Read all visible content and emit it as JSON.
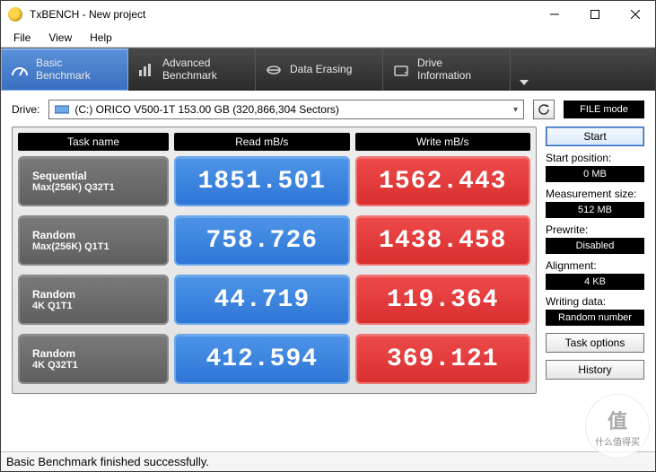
{
  "window": {
    "title": "TxBENCH - New project"
  },
  "menu": {
    "file": "File",
    "view": "View",
    "help": "Help"
  },
  "tabs": {
    "basic": "Basic\nBenchmark",
    "advanced": "Advanced\nBenchmark",
    "erase": "Data Erasing",
    "drive": "Drive\nInformation"
  },
  "drive": {
    "label": "Drive:",
    "value": "(C:) ORICO V500-1T  153.00 GB (320,866,304 Sectors)",
    "file_mode": "FILE mode"
  },
  "headers": {
    "task": "Task name",
    "read": "Read mB/s",
    "write": "Write mB/s"
  },
  "rows": [
    {
      "t1": "Sequential",
      "t2": "Max(256K) Q32T1",
      "read": "1851.501",
      "write": "1562.443"
    },
    {
      "t1": "Random",
      "t2": "Max(256K) Q1T1",
      "read": "758.726",
      "write": "1438.458"
    },
    {
      "t1": "Random",
      "t2": "4K Q1T1",
      "read": "44.719",
      "write": "119.364"
    },
    {
      "t1": "Random",
      "t2": "4K Q32T1",
      "read": "412.594",
      "write": "369.121"
    }
  ],
  "side": {
    "start": "Start",
    "startpos_lbl": "Start position:",
    "startpos_val": "0 MB",
    "msize_lbl": "Measurement size:",
    "msize_val": "512 MB",
    "prewrite_lbl": "Prewrite:",
    "prewrite_val": "Disabled",
    "align_lbl": "Alignment:",
    "align_val": "4 KB",
    "wdata_lbl": "Writing data:",
    "wdata_val": "Random number",
    "taskopt": "Task options",
    "history": "History"
  },
  "status": "Basic Benchmark finished successfully.",
  "watermark": "值 什么值得买"
}
